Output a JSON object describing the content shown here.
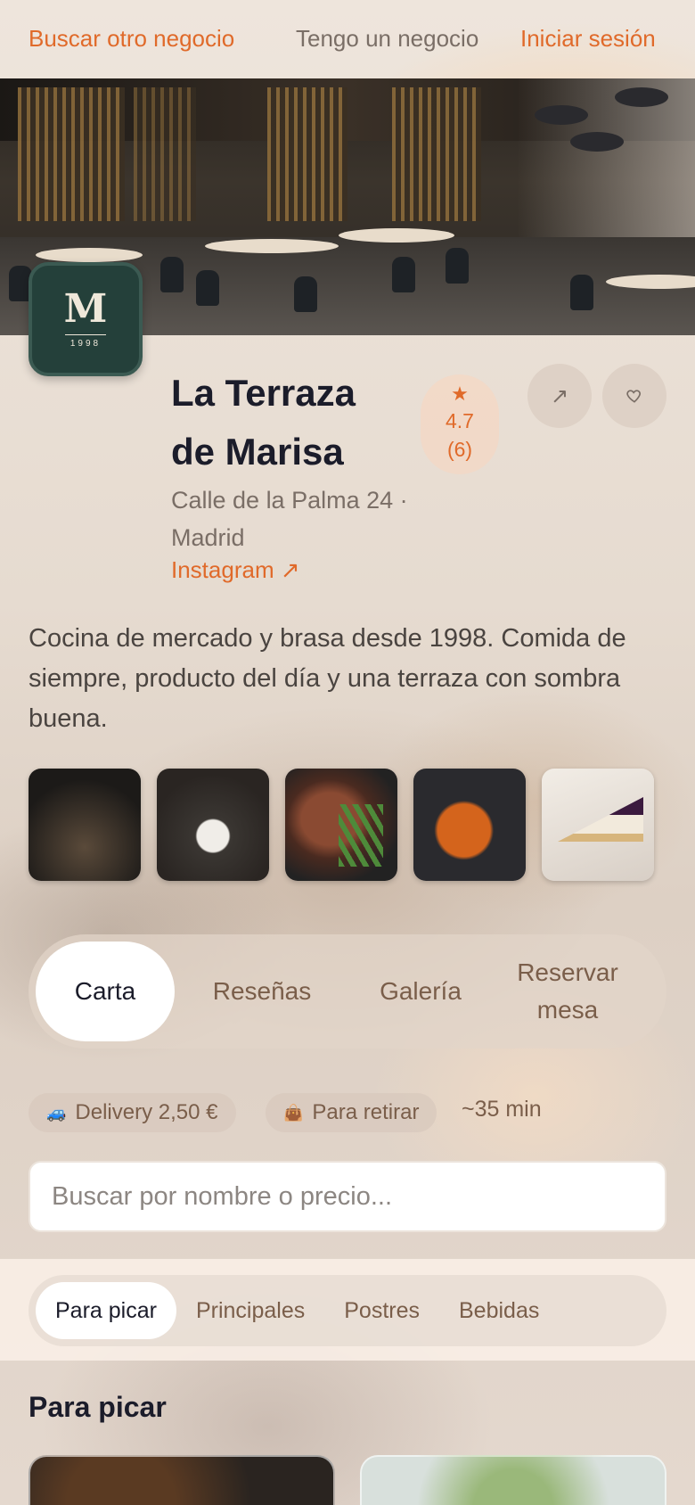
{
  "nav": {
    "find_business": "Buscar otro negocio",
    "own_business": "Tengo un negocio",
    "login": "Iniciar sesión"
  },
  "restaurant": {
    "logo_letter": "M",
    "logo_year": "1998",
    "name": "La Terraza de Marisa",
    "address": "Calle de la Palma 24 · Madrid",
    "instagram": "Instagram ↗",
    "rating_value": "4.7",
    "rating_count": "(6)",
    "description": "Cocina de mercado y brasa desde 1998. Comida de siempre, producto del día y una terraza con sombra buena."
  },
  "icons": {
    "share": "share-icon",
    "favorite": "heart-icon",
    "star": "star-icon",
    "delivery": "car-icon",
    "pickup": "bag-icon"
  },
  "colors": {
    "accent": "#e06a2a",
    "text_dark": "#1b1c2a",
    "text_muted": "#7a6e66",
    "logo_bg": "#24403a"
  },
  "tabs": [
    {
      "label": "Carta",
      "active": true
    },
    {
      "label": "Reseñas",
      "active": false
    },
    {
      "label": "Galería",
      "active": false
    },
    {
      "label": "Reservar mesa",
      "active": false
    }
  ],
  "service": {
    "delivery": "Delivery 2,50 €",
    "pickup": "Para retirar",
    "eta": "~35 min"
  },
  "search": {
    "placeholder": "Buscar por nombre o precio..."
  },
  "categories": [
    {
      "label": "Para picar",
      "active": true
    },
    {
      "label": "Principales",
      "active": false
    },
    {
      "label": "Postres",
      "active": false
    },
    {
      "label": "Bebidas",
      "active": false
    }
  ],
  "section": {
    "title": "Para picar"
  }
}
